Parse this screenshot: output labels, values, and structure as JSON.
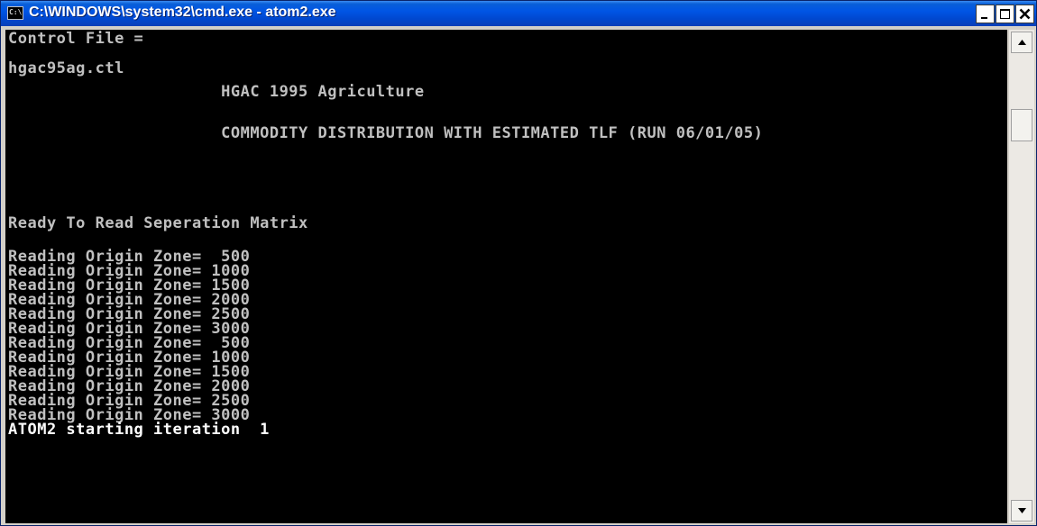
{
  "window": {
    "title": "C:\\WINDOWS\\system32\\cmd.exe - atom2.exe",
    "icon_label": "C:\\"
  },
  "console": {
    "lines": [
      "Control File =",
      "hgac95ag.ctl",
      "                      HGAC 1995 Agriculture",
      "                      COMMODITY DISTRIBUTION WITH ESTIMATED TLF (RUN 06/01/05)",
      "Ready To Read Seperation Matrix",
      "Reading Origin Zone=  500",
      "Reading Origin Zone= 1000",
      "Reading Origin Zone= 1500",
      "Reading Origin Zone= 2000",
      "Reading Origin Zone= 2500",
      "Reading Origin Zone= 3000",
      "Reading Origin Zone=  500",
      "Reading Origin Zone= 1000",
      "Reading Origin Zone= 1500",
      "Reading Origin Zone= 2000",
      "Reading Origin Zone= 2500",
      "Reading Origin Zone= 3000",
      "ATOM2 starting iteration  1"
    ]
  },
  "icons": {
    "app": "cmd-app-icon",
    "minimize": "minimize-icon",
    "maximize": "maximize-icon",
    "close": "close-icon",
    "scroll_up": "scroll-up-arrow-icon",
    "scroll_down": "scroll-down-arrow-icon"
  },
  "colors": {
    "titlebar": "#0055e5",
    "console_bg": "#000000",
    "console_text": "#c0c0c0",
    "close_button": "#ffffff"
  }
}
